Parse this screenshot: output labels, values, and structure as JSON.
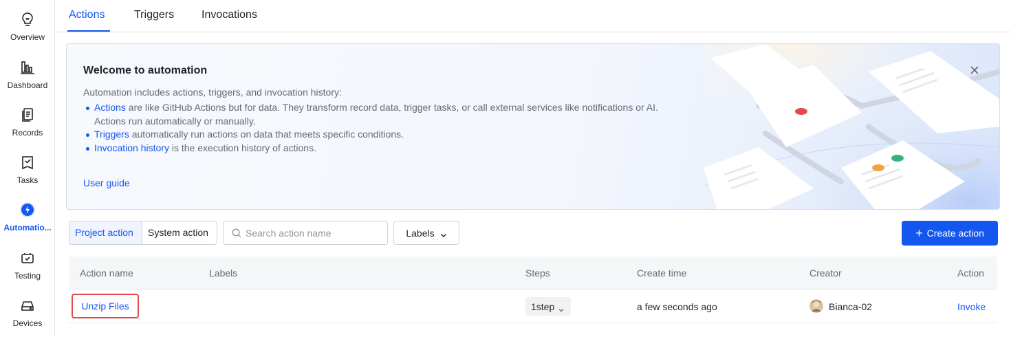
{
  "sidebar": {
    "items": [
      {
        "label": "Overview",
        "icon": "bulb-icon"
      },
      {
        "label": "Dashboard",
        "icon": "bar-chart-icon"
      },
      {
        "label": "Records",
        "icon": "records-icon"
      },
      {
        "label": "Tasks",
        "icon": "tasks-icon"
      },
      {
        "label": "Automatio...",
        "icon": "lightning-icon"
      },
      {
        "label": "Testing",
        "icon": "testing-icon"
      },
      {
        "label": "Devices",
        "icon": "devices-icon"
      }
    ]
  },
  "tabs": [
    {
      "label": "Actions"
    },
    {
      "label": "Triggers"
    },
    {
      "label": "Invocations"
    }
  ],
  "banner": {
    "title": "Welcome to automation",
    "intro": "Automation includes actions, triggers, and invocation history:",
    "items": [
      {
        "link": "Actions",
        "text": " are like GitHub Actions but for data. They transform record data, trigger tasks, or call external services like notifications or AI.",
        "text2": "Actions run automatically or manually."
      },
      {
        "link": "Triggers",
        "text": " automatically run actions on data that meets specific conditions."
      },
      {
        "link": "Invocation history",
        "text": " is the execution history of actions."
      }
    ],
    "user_guide": "User guide"
  },
  "toolbar": {
    "project_action": "Project action",
    "system_action": "System action",
    "search_placeholder": "Search action name",
    "labels": "Labels",
    "create_action": "Create action"
  },
  "table": {
    "headers": {
      "action_name": "Action name",
      "labels": "Labels",
      "steps": "Steps",
      "create_time": "Create time",
      "creator": "Creator",
      "action": "Action"
    },
    "rows": [
      {
        "action_name": "Unzip Files",
        "labels": "",
        "steps": "1step",
        "create_time": "a few seconds ago",
        "creator": "Bianca-02",
        "action": "Invoke"
      }
    ]
  },
  "colors": {
    "accent": "#1456f0",
    "highlight": "#e5484d"
  }
}
